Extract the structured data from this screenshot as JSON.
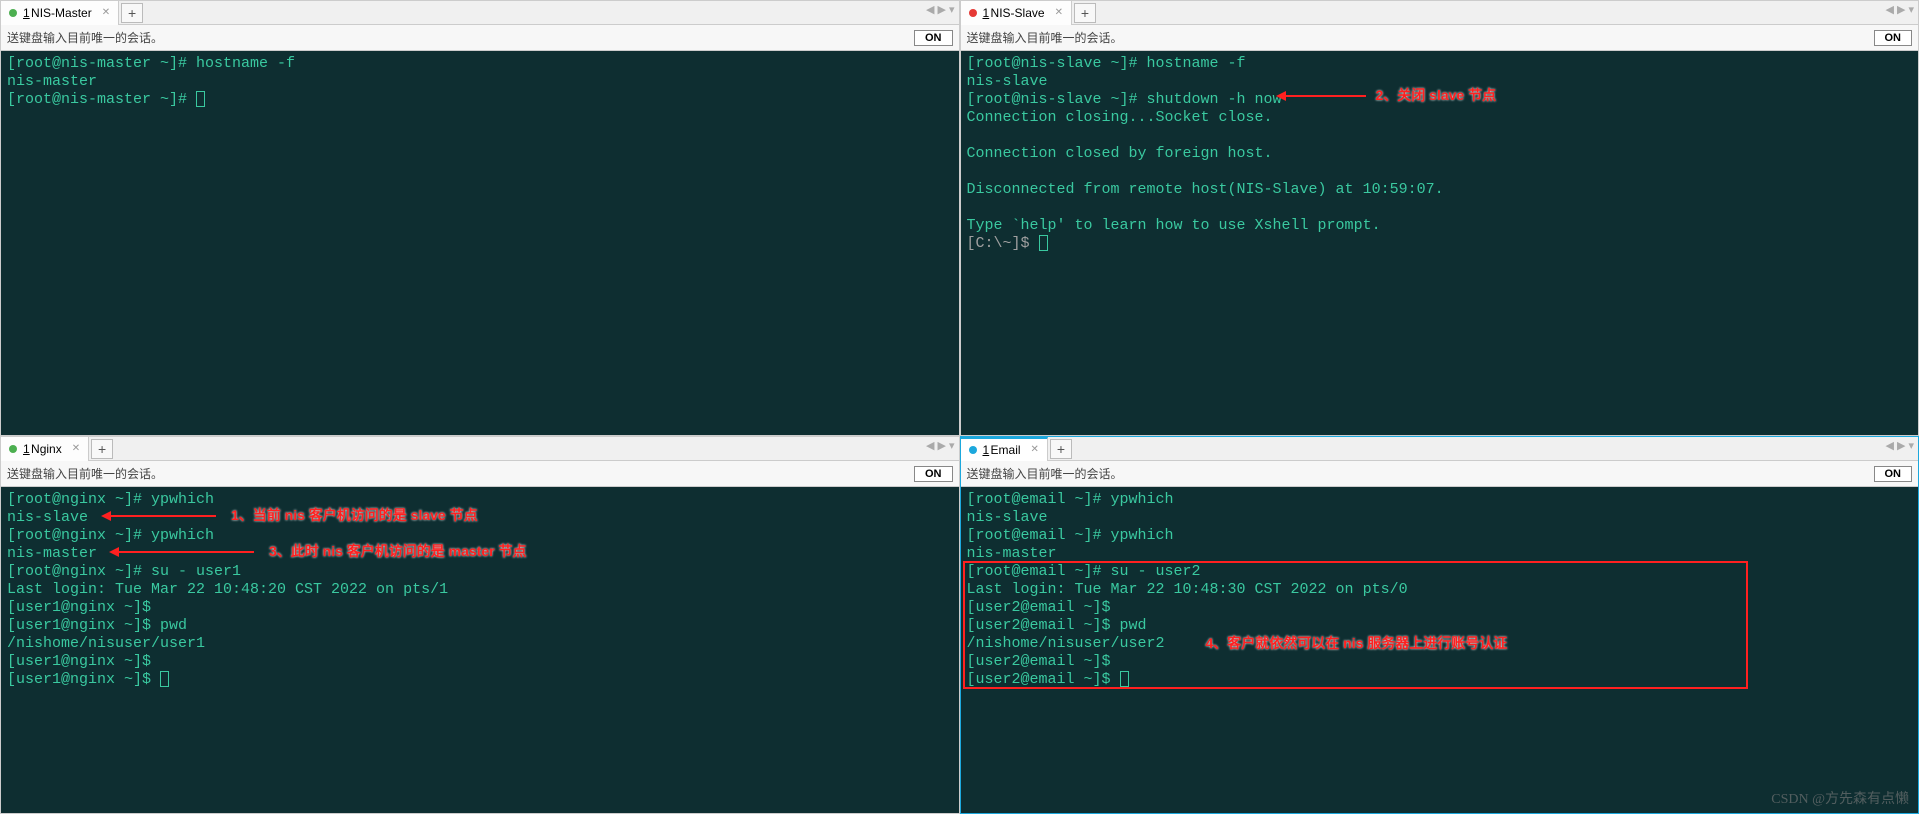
{
  "panes": {
    "tl": {
      "tab_num": "1",
      "tab_label": "NIS-Master",
      "dot": "green",
      "toolbar_text": "送键盘输入目前唯一的会话。",
      "on": "ON",
      "lines": [
        "[root@nis-master ~]# hostname -f",
        "nis-master",
        "[root@nis-master ~]# "
      ]
    },
    "tr": {
      "tab_num": "1",
      "tab_label": "NIS-Slave",
      "dot": "red",
      "toolbar_text": "送键盘输入目前唯一的会话。",
      "on": "ON",
      "lines": [
        "[root@nis-slave ~]# hostname -f",
        "nis-slave",
        "[root@nis-slave ~]# shutdown -h now",
        "Connection closing...Socket close.",
        "",
        "Connection closed by foreign host.",
        "",
        "Disconnected from remote host(NIS-Slave) at 10:59:07.",
        "",
        "Type `help' to learn how to use Xshell prompt.",
        "[C:\\~]$ "
      ],
      "annot2": "2、关闭 slave 节点"
    },
    "bl": {
      "tab_num": "1",
      "tab_label": "Nginx",
      "dot": "green",
      "toolbar_text": "送键盘输入目前唯一的会话。",
      "on": "ON",
      "lines": [
        "[root@nginx ~]# ypwhich",
        "nis-slave",
        "[root@nginx ~]# ypwhich",
        "nis-master",
        "[root@nginx ~]# su - user1",
        "Last login: Tue Mar 22 10:48:20 CST 2022 on pts/1",
        "[user1@nginx ~]$",
        "[user1@nginx ~]$ pwd",
        "/nishome/nisuser/user1",
        "[user1@nginx ~]$",
        "[user1@nginx ~]$ "
      ],
      "annot1": "1、当前 nis 客户机访问的是 slave 节点",
      "annot3": "3、此时 nis 客户机访问的是 master 节点"
    },
    "br": {
      "tab_num": "1",
      "tab_label": "Email",
      "dot": "blue",
      "toolbar_text": "送键盘输入目前唯一的会话。",
      "on": "ON",
      "lines": [
        "[root@email ~]# ypwhich",
        "nis-slave",
        "[root@email ~]# ypwhich",
        "nis-master",
        "[root@email ~]# su - user2",
        "Last login: Tue Mar 22 10:48:30 CST 2022 on pts/0",
        "[user2@email ~]$",
        "[user2@email ~]$ pwd",
        "/nishome/nisuser/user2",
        "[user2@email ~]$",
        "[user2@email ~]$ "
      ],
      "annot4": "4、客户就依然可以在 nis 服务器上进行账号认证"
    }
  },
  "watermark": "CSDN @方先森有点懒"
}
